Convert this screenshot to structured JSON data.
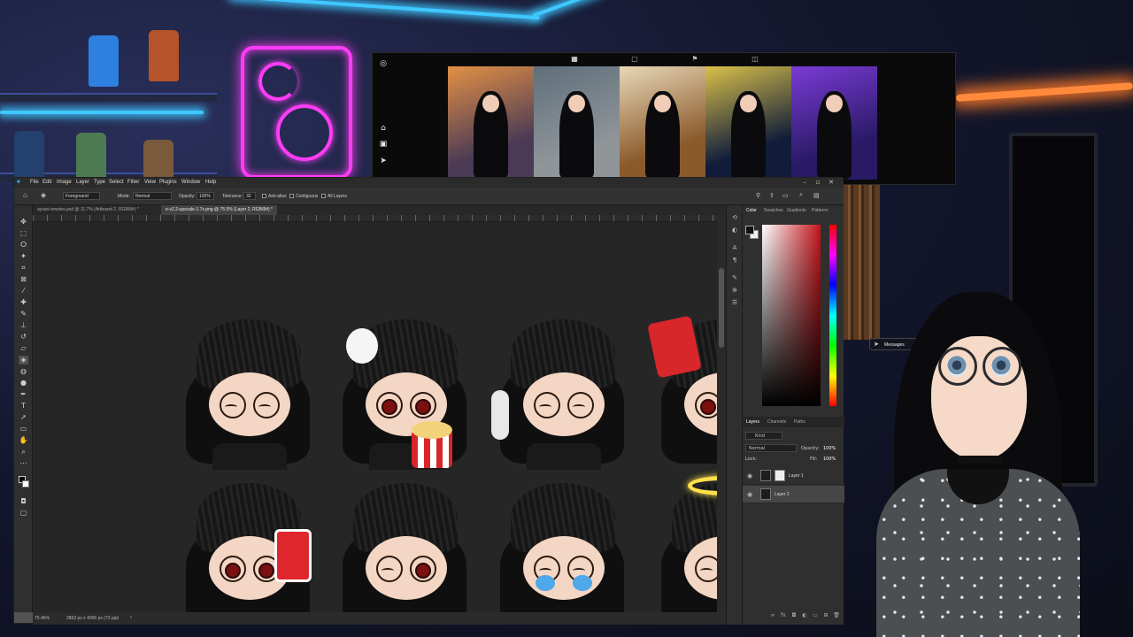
{
  "instagram": {
    "thumbnails": [
      {
        "bg": "#4a3a55",
        "accent": "#e39045"
      },
      {
        "bg": "#8f9599",
        "accent": "#5f6f7a"
      },
      {
        "bg": "#8b5a2b",
        "accent": "#e8d8b8"
      },
      {
        "bg": "#101c3a",
        "accent": "#d9c04a"
      },
      {
        "bg": "#2a1a66",
        "accent": "#7a3ad6"
      }
    ]
  },
  "photoshop": {
    "menu": [
      "File",
      "Edit",
      "Image",
      "Layer",
      "Type",
      "Select",
      "Filter",
      "View",
      "Plugins",
      "Window",
      "Help"
    ],
    "options": {
      "source": "Foreground",
      "mode_label": "Mode:",
      "mode_value": "Normal",
      "opacity_label": "Opacity:",
      "opacity_value": "100%",
      "tolerance_label": "Tolerance:",
      "tolerance_value": "32",
      "anti_alias": "Anti-alias",
      "contiguous": "Contiguous",
      "all_layers": "All Layers"
    },
    "tabs": [
      "aysart-emotes.psd @ 11.7% (Artboard 2, RGB/8#) *",
      "e-v2.2-upscale-1.7x.png @ 75.5% (Layer 2, RGB/8#) *"
    ],
    "status": {
      "zoom": "75.46%",
      "size": "2893 px x 4006 px (72 ppi)"
    },
    "color_panel_tabs": [
      "Color",
      "Swatches",
      "Gradients",
      "Patterns"
    ],
    "layers_panel_tabs": [
      "Layers",
      "Channels",
      "Paths"
    ],
    "layers_filter": "Kind",
    "blend_mode": "Normal",
    "opacity_label": "Opacity:",
    "opacity_value": "100%",
    "lock_label": "Lock:",
    "fill_label": "Fill:",
    "fill_value": "100%",
    "layers": [
      {
        "name": "Layer 1",
        "selected": false
      },
      {
        "name": "Layer 2",
        "selected": true
      }
    ]
  },
  "messages": {
    "label": "Messages"
  }
}
